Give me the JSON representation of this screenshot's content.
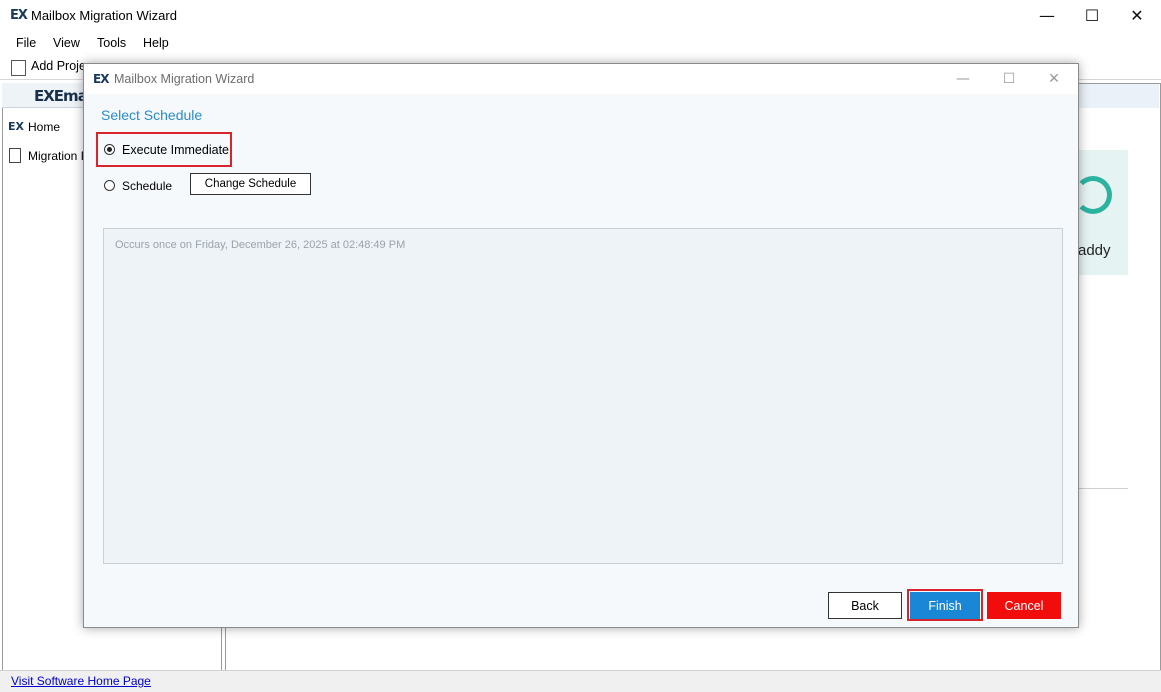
{
  "main_window": {
    "logo": "EX",
    "title": "Mailbox Migration Wizard",
    "controls": {
      "minimize": "—",
      "maximize": "☐",
      "close": "✕"
    }
  },
  "menu": [
    "File",
    "View",
    "Tools",
    "Help"
  ],
  "toolbar": {
    "add_project_label": "Add Proje"
  },
  "left_pane": {
    "logo": "EXEma",
    "items": [
      {
        "label": "Home",
        "icon": "ex-logo-icon"
      },
      {
        "label": "Migration Pr",
        "icon": "document-icon"
      }
    ]
  },
  "right_pane": {
    "card_text": "addy"
  },
  "status_bar": {
    "link": "Visit Software Home Page"
  },
  "dialog": {
    "logo": "EX",
    "title": "Mailbox Migration Wizard",
    "section_title": "Select Schedule",
    "options": {
      "execute_immediate": "Execute Immediate",
      "schedule": "Schedule",
      "selected": "execute_immediate"
    },
    "change_schedule_label": "Change Schedule",
    "info_text": "Occurs once on Friday, December 26, 2025 at 02:48:49 PM",
    "buttons": {
      "back": "Back",
      "finish": "Finish",
      "cancel": "Cancel"
    },
    "colors": {
      "accent": "#2c8bc9",
      "finish": "#1a86d6",
      "cancel": "#f20d0d",
      "highlight": "#d6262c"
    }
  }
}
